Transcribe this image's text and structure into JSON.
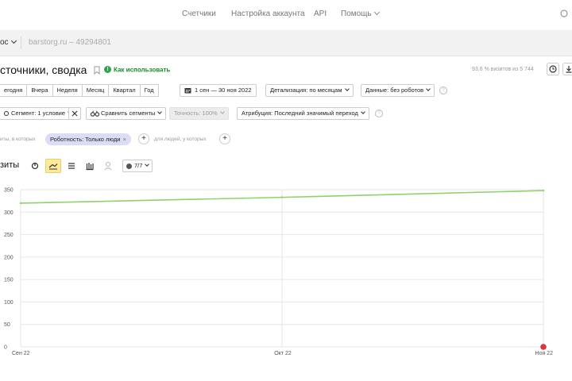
{
  "topnav": {
    "items": [
      "Счетчики",
      "Настройка аккаунта",
      "API",
      "Помощь"
    ]
  },
  "sitebar": {
    "prefix": "ос",
    "site": "barstorg.ru – 49294801"
  },
  "report": {
    "title": "сточники, сводка",
    "howto": "Как использовать",
    "visits_info": "93,6 % визитов из 5 744"
  },
  "periods": [
    "егодня",
    "Вчера",
    "Неделя",
    "Месяц",
    "Квартал",
    "Год"
  ],
  "controls": {
    "date_range": "1 сен — 30 ноя 2022",
    "detail": "Детализация: по месяцам",
    "data": "Данные: без роботов",
    "segment": "Сегмент: 1 условие",
    "compare": "Сравнить сегменты",
    "accuracy": "Точность: 100%",
    "attribution": "Атрибуция: Последний значимый переход"
  },
  "filters": {
    "left_text": "иты, в которых",
    "chip": "Роботность: Только люди",
    "right_text": "для людей, у которых"
  },
  "viz": {
    "title": "зиты",
    "counter": "7/7"
  },
  "chart_data": {
    "type": "line",
    "x": [
      "Сен 22",
      "Окт 22",
      "Ноя 22"
    ],
    "series": [
      {
        "values": [
          320,
          333,
          348
        ]
      }
    ],
    "ylim": [
      0,
      350
    ],
    "yticks": [
      0,
      50,
      100,
      150,
      200,
      250,
      300,
      350
    ],
    "grid": true,
    "colors": {
      "line": "#8fd16a",
      "grid": "#e6e6e6",
      "marker": "#d9363e"
    }
  }
}
